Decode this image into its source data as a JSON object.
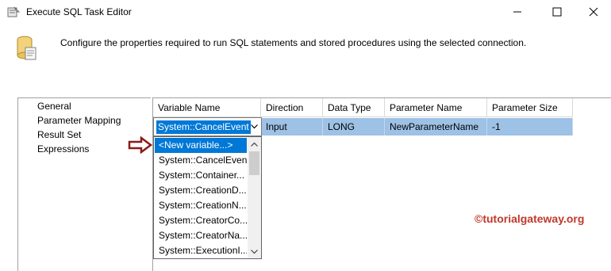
{
  "window": {
    "title": "Execute SQL Task Editor"
  },
  "header": {
    "description": "Configure the properties required to run SQL statements and stored procedures using the selected connection."
  },
  "nav": {
    "items": [
      "General",
      "Parameter Mapping",
      "Result Set",
      "Expressions"
    ]
  },
  "grid": {
    "columns": [
      "Variable Name",
      "Direction",
      "Data Type",
      "Parameter Name",
      "Parameter Size"
    ],
    "row": {
      "variable": "System::CancelEvent",
      "direction": "Input",
      "data_type": "LONG",
      "parameter_name": "NewParameterName",
      "parameter_size": "-1"
    }
  },
  "dropdown": {
    "items": [
      "<New variable...>",
      "System::CancelEvent",
      "System::Container...",
      "System::CreationD...",
      "System::CreationN...",
      "System::CreatorCo...",
      "System::CreatorNa...",
      "System::ExecutionI..."
    ],
    "selected_index": 0
  },
  "watermark": "©tutorialgateway.org",
  "colors": {
    "selection": "#0078d7",
    "row_highlight": "#9ec1e6",
    "watermark": "#c0392b",
    "arrow": "#8b1a1a"
  },
  "icons": {
    "app": "package-icon",
    "minimize": "minimize-icon",
    "maximize": "maximize-icon",
    "close": "close-icon"
  }
}
